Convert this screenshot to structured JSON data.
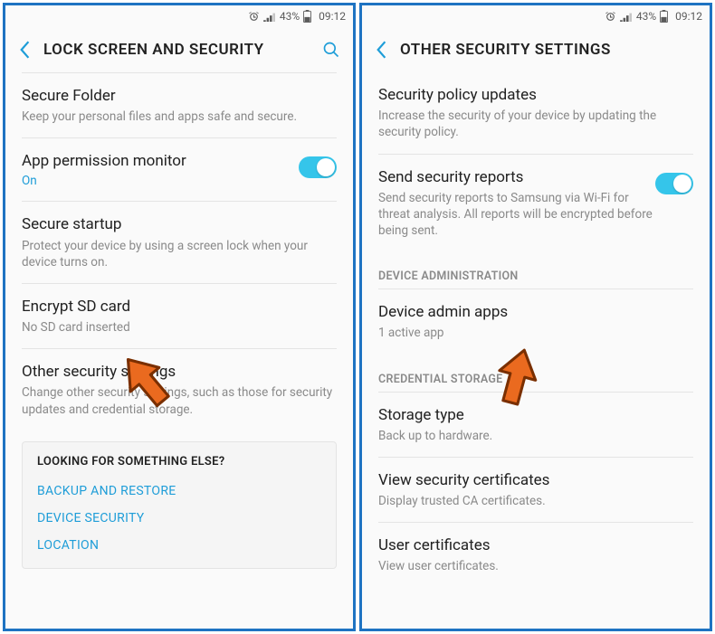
{
  "status": {
    "battery": "43%",
    "time": "09:12"
  },
  "left": {
    "title": "LOCK SCREEN AND SECURITY",
    "items": [
      {
        "t": "Secure Folder",
        "s": "Keep your personal files and apps safe and secure."
      },
      {
        "t": "App permission monitor",
        "v": "On",
        "toggle": true
      },
      {
        "t": "Secure startup",
        "s": "Protect your device by using a screen lock when your device turns on."
      },
      {
        "t": "Encrypt SD card",
        "s": "No SD card inserted"
      },
      {
        "t": "Other security settings",
        "s": "Change other security settings, such as those for security updates and credential storage."
      }
    ],
    "footer": {
      "title": "LOOKING FOR SOMETHING ELSE?",
      "links": [
        "BACKUP AND RESTORE",
        "DEVICE SECURITY",
        "LOCATION"
      ]
    }
  },
  "right": {
    "title": "OTHER SECURITY SETTINGS",
    "items1": [
      {
        "t": "Security policy updates",
        "s": "Increase the security of your device by updating the security policy."
      },
      {
        "t": "Send security reports",
        "s": "Send security reports to Samsung via Wi-Fi for threat analysis. All reports will be encrypted before being sent.",
        "toggle": true
      }
    ],
    "sec1": "DEVICE ADMINISTRATION",
    "items2": [
      {
        "t": "Device admin apps",
        "s": "1 active app"
      }
    ],
    "sec2": "CREDENTIAL STORAGE",
    "items3": [
      {
        "t": "Storage type",
        "s": "Back up to hardware."
      },
      {
        "t": "View security certificates",
        "s": "Display trusted CA certificates."
      },
      {
        "t": "User certificates",
        "s": "View user certificates."
      }
    ]
  }
}
